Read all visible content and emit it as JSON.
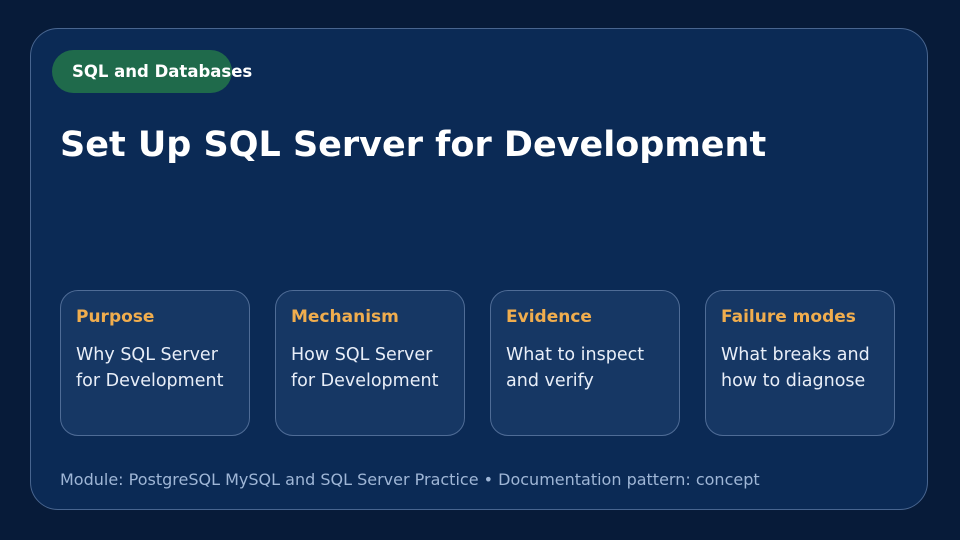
{
  "tag": {
    "label": "SQL and Databases",
    "color": "#1f6a4b"
  },
  "title": "Set Up SQL Server for Development",
  "cards": [
    {
      "heading": "Purpose",
      "body": "Why SQL Server for Development"
    },
    {
      "heading": "Mechanism",
      "body": "How SQL Server for Development"
    },
    {
      "heading": "Evidence",
      "body": "What to inspect and verify"
    },
    {
      "heading": "Failure modes",
      "body": "What breaks and how to diagnose"
    }
  ],
  "footer": {
    "text": "Module: PostgreSQL MySQL and SQL Server Practice  •  Documentation pattern: concept"
  },
  "colors": {
    "background": "#071b39",
    "panel": "#0b2a55",
    "card": "#163764",
    "accent": "#f0ad4e"
  }
}
